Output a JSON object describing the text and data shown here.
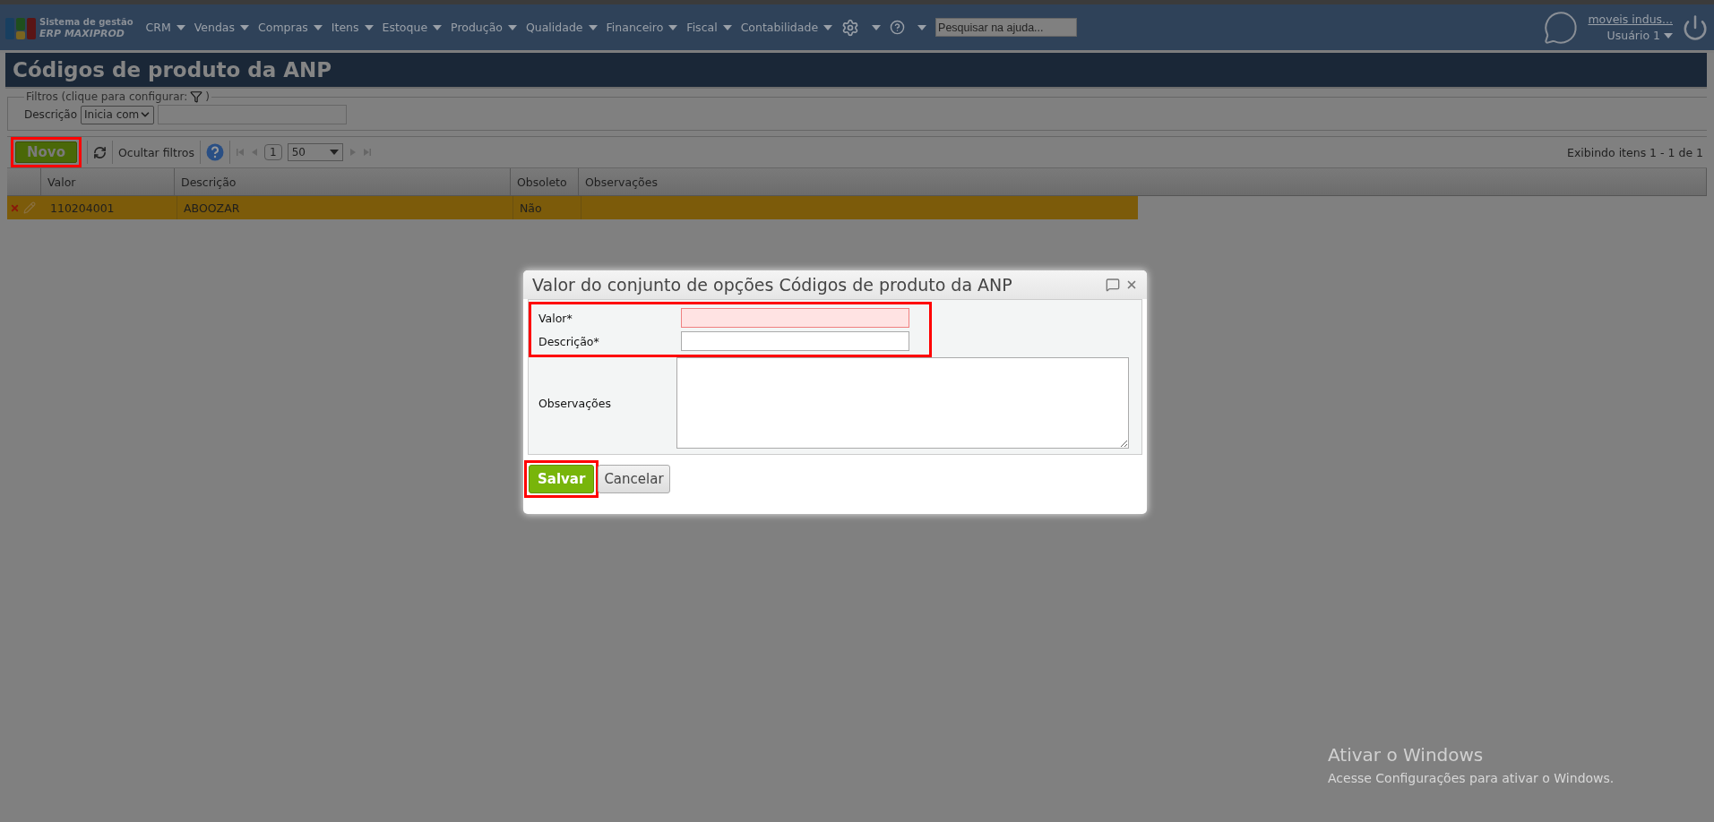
{
  "nav": {
    "logo_line1": "Sistema de gestão",
    "logo_line2": "ERP MAXIPROD",
    "menus": [
      "CRM",
      "Vendas",
      "Compras",
      "Itens",
      "Estoque",
      "Produção",
      "Qualidade",
      "Financeiro",
      "Fiscal",
      "Contabilidade"
    ],
    "search": {
      "placeholder": "Pesquisar na ajuda..."
    },
    "account": {
      "company": "moveis indus...",
      "user": "Usuário 1"
    }
  },
  "page_title": "Códigos de produto da ANP",
  "filters": {
    "legend": "Filtros (clique para configurar:",
    "legend_end": ")",
    "field_label": "Descrição",
    "operator": "Inicia com"
  },
  "toolbar": {
    "new_button": {
      "label": "Novo",
      "highlighted": true
    },
    "hide_filters": "Ocultar filtros",
    "page": "1",
    "page_size": "50",
    "summary": "Exibindo itens 1 - 1 de 1"
  },
  "table": {
    "columns": [
      "Valor",
      "Descrição",
      "Obsoleto",
      "Observações"
    ],
    "rows": [
      {
        "valor": "110204001",
        "descricao": "ABOOZAR",
        "obsoleto": "Não",
        "selected": true
      }
    ]
  },
  "dialog": {
    "title": "Valor do conjunto de opções Códigos de produto da ANP",
    "required_highlighted": true,
    "required_fields": [
      {
        "label": "Valor*",
        "invalid": true
      },
      {
        "label": "Descrição*",
        "invalid": false
      }
    ],
    "notes_label": "Observações",
    "save": {
      "label": "Salvar",
      "highlighted": true
    },
    "cancel": "Cancelar"
  },
  "os_notice": {
    "title": "Ativar o Windows",
    "text": "Acesse Configurações para ativar o Windows."
  }
}
